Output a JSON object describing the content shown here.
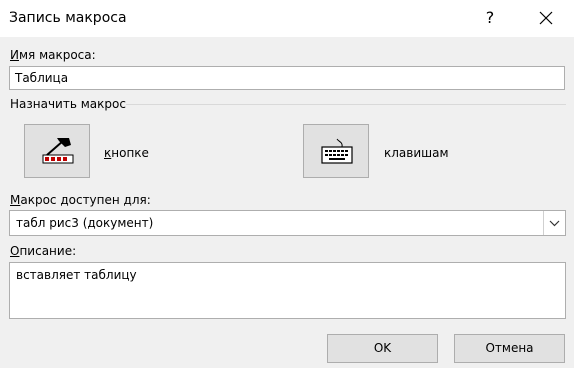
{
  "window": {
    "title": "Запись макроса",
    "help_glyph": "?",
    "close_icon": "close-icon"
  },
  "macro_name": {
    "label_first": "И",
    "label_rest": "мя макроса:",
    "value": "Таблица"
  },
  "assign": {
    "group_label": "Назначить макрос",
    "button_label_first": "к",
    "button_label_rest": "нопке",
    "button_icon": "hammer-toolbar-icon",
    "keyboard_label": "клавишам",
    "keyboard_icon": "keyboard-icon"
  },
  "store_in": {
    "label_first": "М",
    "label_rest": "акрос доступен для:",
    "value": "табл рис3 (документ)"
  },
  "description": {
    "label_first": "О",
    "label_rest": "писание:",
    "value": "вставляет таблицу"
  },
  "buttons": {
    "ok": "OK",
    "cancel": "Отмена"
  }
}
